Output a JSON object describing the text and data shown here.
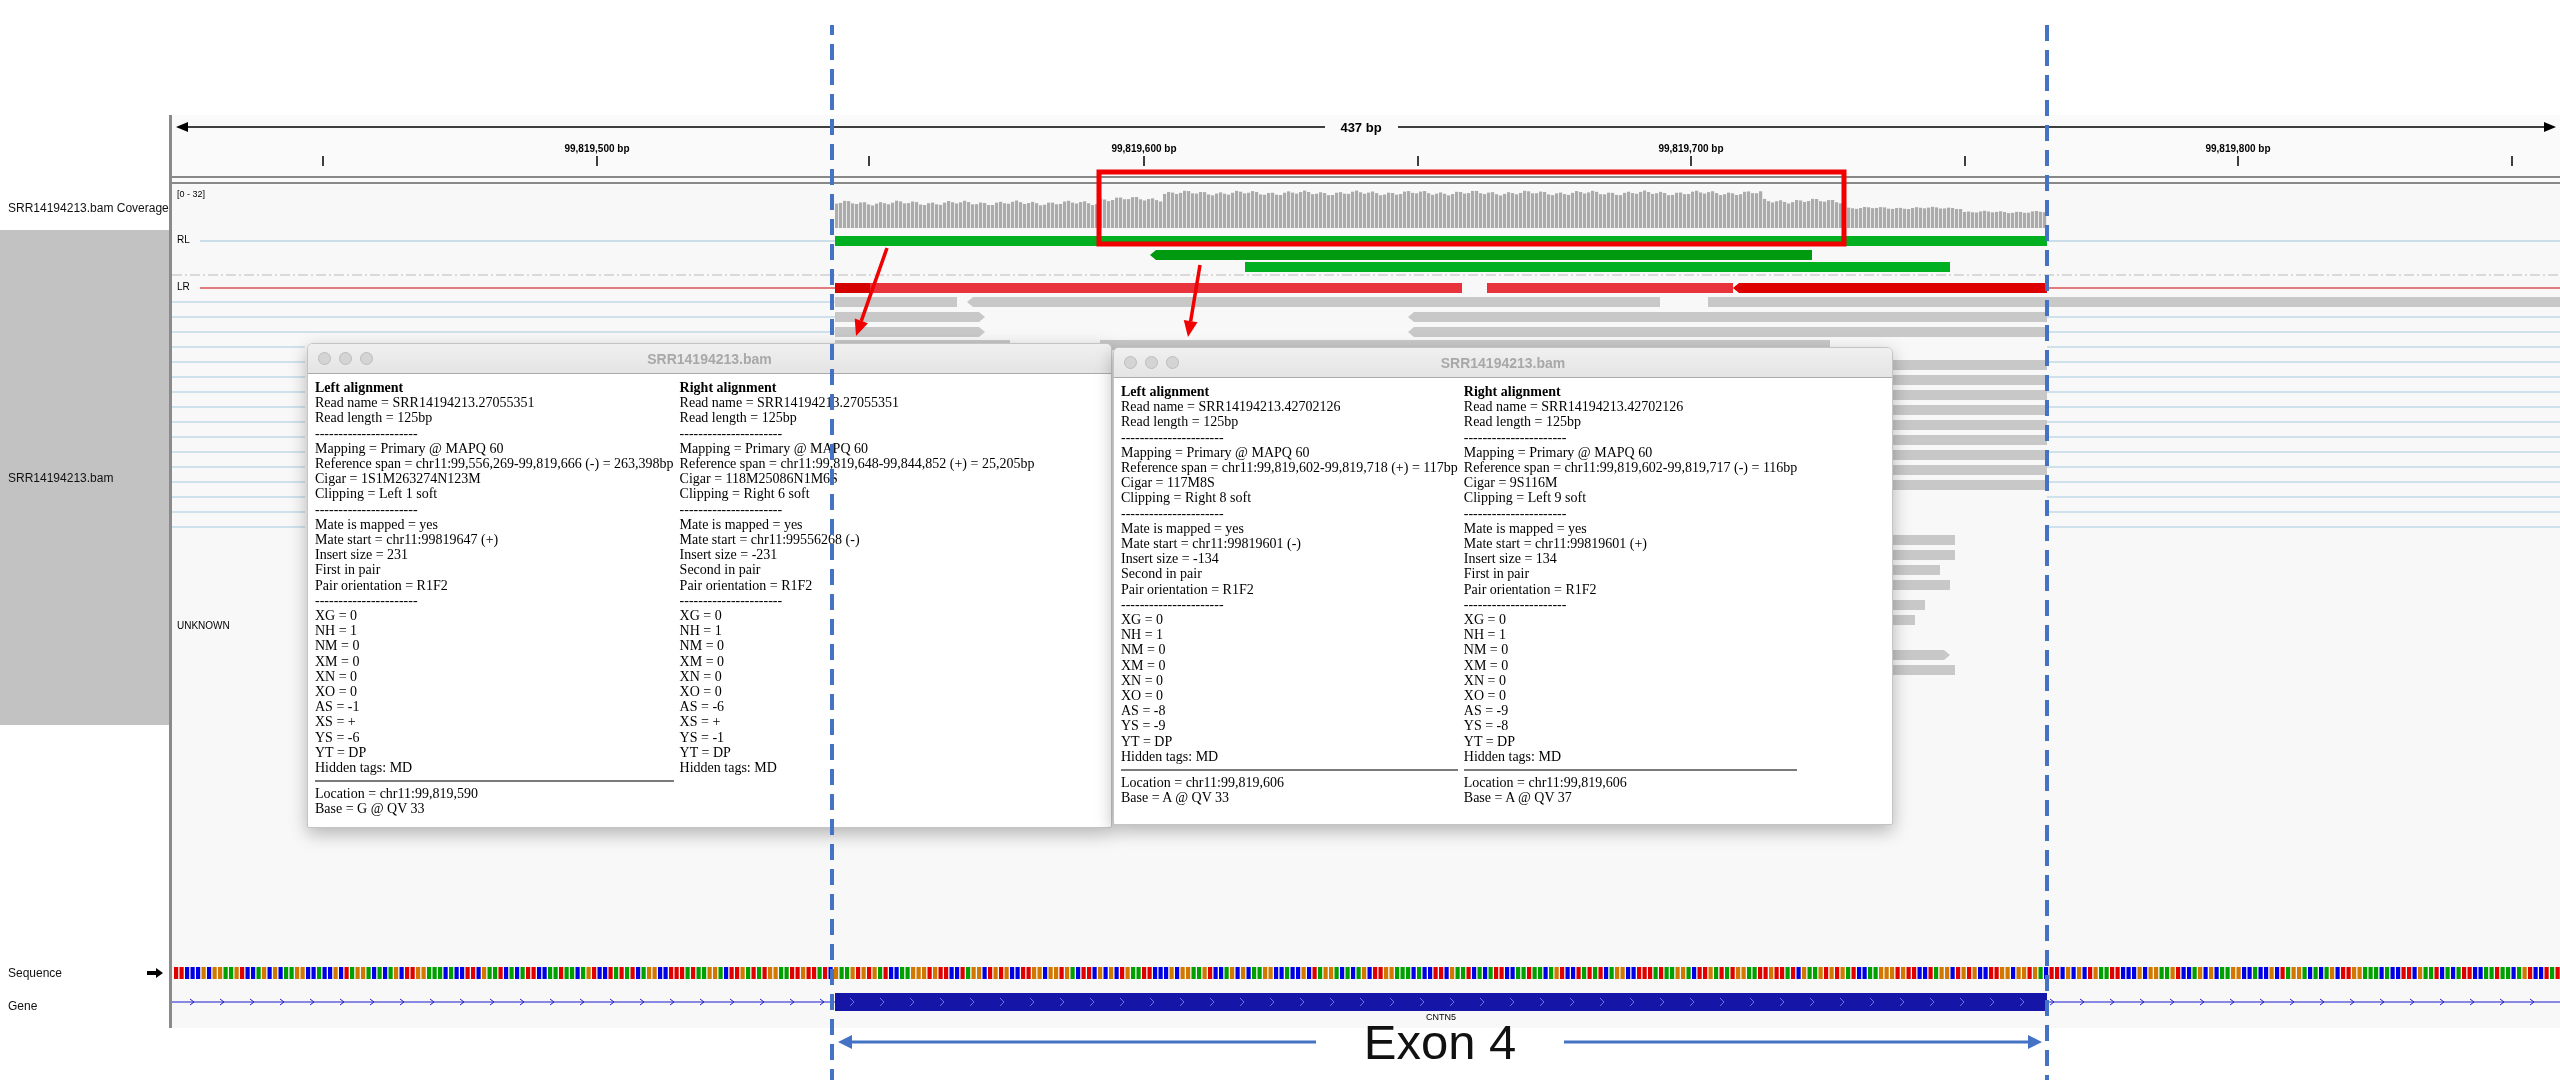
{
  "ruler": {
    "span": "437 bp",
    "ticks": [
      "99,819,500 bp",
      "99,819,600 bp",
      "99,819,700 bp",
      "99,819,800 bp"
    ]
  },
  "tracks": [
    {
      "kind": "coverage",
      "name": "SRR14194213.bam Coverage",
      "range": "[0 - 32]"
    },
    {
      "kind": "alignment",
      "name": "SRR14194213.bam",
      "groups": [
        "RL",
        "LR",
        "UNKNOWN"
      ]
    },
    {
      "kind": "sequence",
      "name": "Sequence"
    },
    {
      "kind": "gene",
      "name": "Gene",
      "feature": "CNTN5"
    }
  ],
  "popups": [
    {
      "title": "SRR14194213.bam",
      "columns": [
        {
          "heading": "Left alignment",
          "lines": [
            "Read name = SRR14194213.27055351",
            "Read length = 125bp",
            "----------------------",
            "Mapping = Primary @ MAPQ 60",
            "Reference span = chr11:99,556,269-99,819,666 (-) = 263,398bp",
            "Cigar = 1S1M263274N123M",
            "Clipping = Left 1 soft",
            "----------------------",
            "Mate is mapped = yes",
            "Mate start = chr11:99819647 (+)",
            "Insert size = 231",
            "First in pair",
            "Pair orientation = R1F2",
            "----------------------",
            "XG = 0",
            "NH = 1",
            "NM = 0",
            "XM = 0",
            "XN = 0",
            "XO = 0",
            "AS = -1",
            "XS = +",
            "YS = -6",
            "YT = DP",
            "Hidden tags: MD"
          ],
          "footer": [
            "Location = chr11:99,819,590",
            "Base = G @ QV 33"
          ]
        },
        {
          "heading": "Right alignment",
          "lines": [
            "Read name = SRR14194213.27055351",
            "Read length = 125bp",
            "----------------------",
            "Mapping = Primary @ MAPQ 60",
            "Reference span = chr11:99,819,648-99,844,852 (+) = 25,205bp",
            "Cigar = 118M25086N1M6S",
            "Clipping = Right 6 soft",
            "----------------------",
            "Mate is mapped = yes",
            "Mate start = chr11:99556268 (-)",
            "Insert size = -231",
            "Second in pair",
            "Pair orientation = R1F2",
            "----------------------",
            "XG = 0",
            "NH = 1",
            "NM = 0",
            "XM = 0",
            "XN = 0",
            "XO = 0",
            "AS = -6",
            "XS = +",
            "YS = -1",
            "YT = DP",
            "Hidden tags: MD"
          ]
        }
      ]
    },
    {
      "title": "SRR14194213.bam",
      "columns": [
        {
          "heading": "Left alignment",
          "lines": [
            "Read name = SRR14194213.42702126",
            "Read length = 125bp",
            "----------------------",
            "Mapping = Primary @ MAPQ 60",
            "Reference span = chr11:99,819,602-99,819,718 (+) = 117bp",
            "Cigar = 117M8S",
            "Clipping = Right 8 soft",
            "----------------------",
            "Mate is mapped = yes",
            "Mate start = chr11:99819601 (-)",
            "Insert size = -134",
            "Second in pair",
            "Pair orientation = R1F2",
            "----------------------",
            "XG = 0",
            "NH = 1",
            "NM = 0",
            "XM = 0",
            "XN = 0",
            "XO = 0",
            "AS = -8",
            "YS = -9",
            "YT = DP",
            "Hidden tags: MD"
          ],
          "footer": [
            "Location = chr11:99,819,606",
            "Base = A @ QV 33"
          ]
        },
        {
          "heading": "Right alignment",
          "lines": [
            "Read name = SRR14194213.42702126",
            "Read length = 125bp",
            "----------------------",
            "Mapping = Primary @ MAPQ 60",
            "Reference span = chr11:99,819,602-99,819,717 (-) = 116bp",
            "Cigar = 9S116M",
            "Clipping = Left 9 soft",
            "----------------------",
            "Mate is mapped = yes",
            "Mate start = chr11:99819601 (+)",
            "Insert size = 134",
            "First in pair",
            "Pair orientation = R1F2",
            "----------------------",
            "XG = 0",
            "NH = 1",
            "NM = 0",
            "XM = 0",
            "XN = 0",
            "XO = 0",
            "AS = -9",
            "YS = -8",
            "YT = DP",
            "Hidden tags: MD"
          ],
          "footer": [
            "Location = chr11:99,819,606",
            "Base = A @ QV 37"
          ]
        }
      ]
    }
  ],
  "annotation": {
    "label": "Exon 4"
  }
}
